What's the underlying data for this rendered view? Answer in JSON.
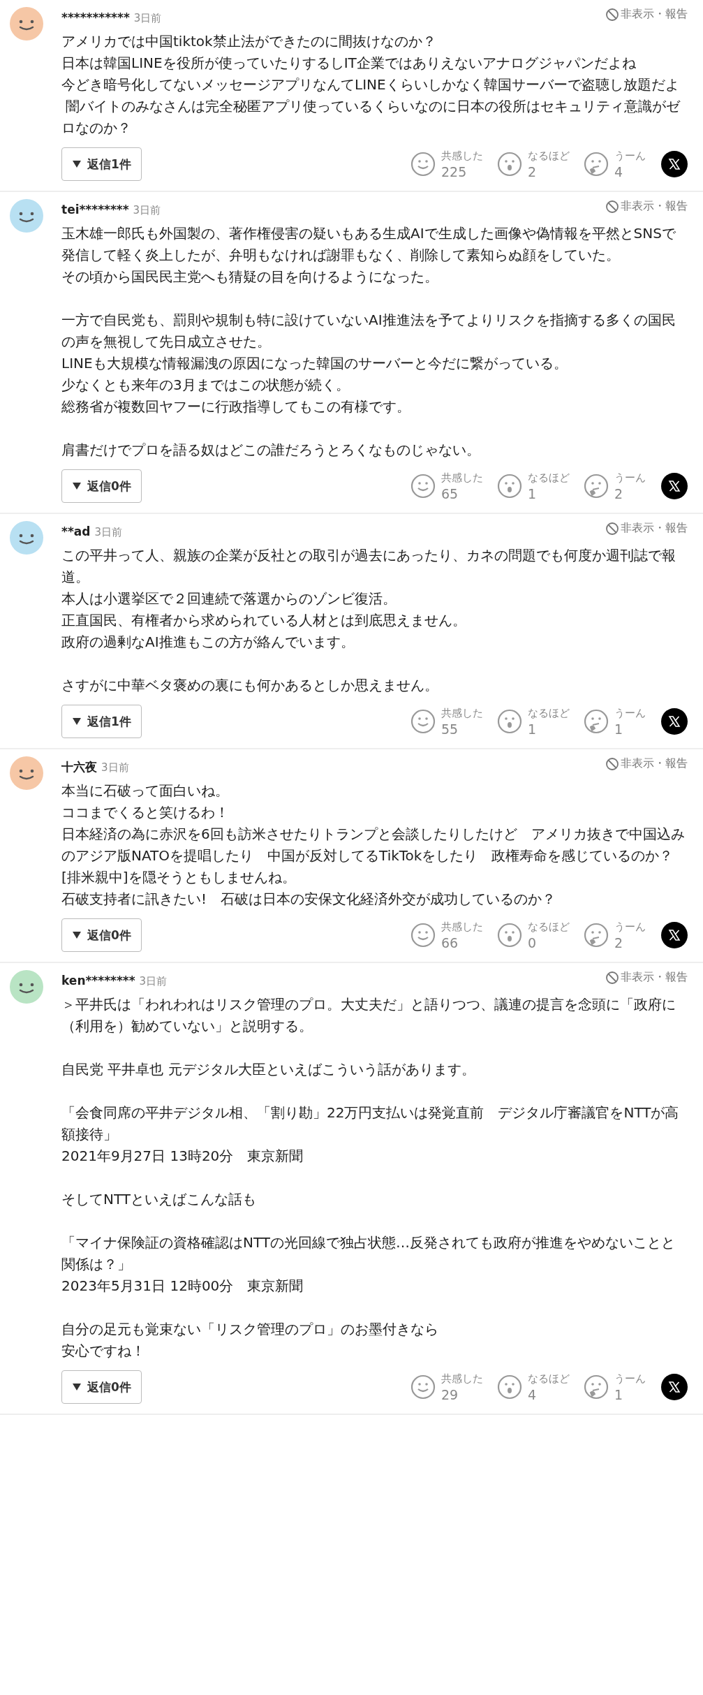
{
  "comments": [
    {
      "user": "***********",
      "time": "3日前",
      "hide_report": "非表示・報告",
      "blocks": [
        [
          "アメリカでは中国tiktok禁止法ができたのに間抜けなのか？",
          "日本は韓国LINEを役所が使っていたりするしIT企業ではありえないアナログジャパンだよね",
          "今どき暗号化してないメッセージアプリなんてLINEくらいしかなく韓国サーバーで盗聴し放題だよ",
          " 闇バイトのみなさんは完全秘匿アプリ使っているくらいなのに日本の役所はセキュリティ意識がゼロなのか？"
        ]
      ],
      "replies": "返信1件",
      "reactions": [
        {
          "label": "共感した",
          "count": "225"
        },
        {
          "label": "なるほど",
          "count": "2"
        },
        {
          "label": "うーん",
          "count": "4"
        }
      ]
    },
    {
      "user": "tei********",
      "time": "3日前",
      "hide_report": "非表示・報告",
      "blocks": [
        [
          "玉木雄一郎氏も外国製の、著作権侵害の疑いもある生成AIで生成した画像や偽情報を平然とSNSで発信して軽く炎上したが、弁明もなければ謝罪もなく、削除して素知らぬ顔をしていた。",
          "その頃から国民民主党へも猜疑の目を向けるようになった。"
        ],
        [
          "一方で自民党も、罰則や規制も特に設けていないAI推進法を予てよりリスクを指摘する多くの国民の声を無視して先日成立させた。",
          "LINEも大規模な情報漏洩の原因になった韓国のサーバーと今だに繋がっている。",
          "少なくとも来年の3月まではこの状態が続く。",
          "総務省が複数回ヤフーに行政指導してもこの有様です。"
        ],
        [
          "肩書だけでプロを語る奴はどこの誰だろうとろくなものじゃない。"
        ]
      ],
      "replies": "返信0件",
      "reactions": [
        {
          "label": "共感した",
          "count": "65"
        },
        {
          "label": "なるほど",
          "count": "1"
        },
        {
          "label": "うーん",
          "count": "2"
        }
      ]
    },
    {
      "user": "**ad",
      "time": "3日前",
      "hide_report": "非表示・報告",
      "blocks": [
        [
          "この平井って人、親族の企業が反社との取引が過去にあったり、カネの問題でも何度か週刊誌で報道。",
          "本人は小選挙区で２回連続で落選からのゾンビ復活。",
          "正直国民、有権者から求められている人材とは到底思えません。",
          "政府の過剰なAI推進もこの方が絡んでいます。"
        ],
        [
          "さすがに中華ベタ褒めの裏にも何かあるとしか思えません。"
        ]
      ],
      "replies": "返信1件",
      "reactions": [
        {
          "label": "共感した",
          "count": "55"
        },
        {
          "label": "なるほど",
          "count": "1"
        },
        {
          "label": "うーん",
          "count": "1"
        }
      ]
    },
    {
      "user": "十六夜",
      "time": "3日前",
      "hide_report": "非表示・報告",
      "blocks": [
        [
          "本当に石破って面白いね。",
          "ココまでくると笑けるわ！",
          "日本経済の為に赤沢を6回も訪米させたりトランプと会談したりしたけど　アメリカ抜きで中国込みのアジア版NATOを提唱したり　中国が反対してるTikTokをしたり　政権寿命を感じているのか？[排米親中]を隠そうともしませんね。",
          "石破支持者に訊きたい!　石破は日本の安保文化経済外交が成功しているのか？"
        ]
      ],
      "replies": "返信0件",
      "reactions": [
        {
          "label": "共感した",
          "count": "66"
        },
        {
          "label": "なるほど",
          "count": "0"
        },
        {
          "label": "うーん",
          "count": "2"
        }
      ]
    },
    {
      "user": "ken********",
      "time": "3日前",
      "hide_report": "非表示・報告",
      "blocks": [
        [
          "＞平井氏は「われわれはリスク管理のプロ。大丈夫だ」と語りつつ、議連の提言を念頭に「政府に（利用を）勧めていない」と説明する。"
        ],
        [
          "自民党 平井卓也 元デジタル大臣といえばこういう話があります。"
        ],
        [
          "「会食同席の平井デジタル相、「割り勘」22万円支払いは発覚直前　デジタル庁審議官をNTTが高額接待」",
          "2021年9月27日 13時20分　東京新聞"
        ],
        [
          "そしてNTTといえばこんな話も"
        ],
        [
          "「マイナ保険証の資格確認はNTTの光回線で独占状態…反発されても政府が推進をやめないことと関係は？」",
          "2023年5月31日 12時00分　東京新聞"
        ],
        [
          "自分の足元も覚束ない「リスク管理のプロ」のお墨付きなら",
          "安心ですね！"
        ]
      ],
      "replies": "返信0件",
      "reactions": [
        {
          "label": "共感した",
          "count": "29"
        },
        {
          "label": "なるほど",
          "count": "4"
        },
        {
          "label": "うーん",
          "count": "1"
        }
      ]
    }
  ]
}
